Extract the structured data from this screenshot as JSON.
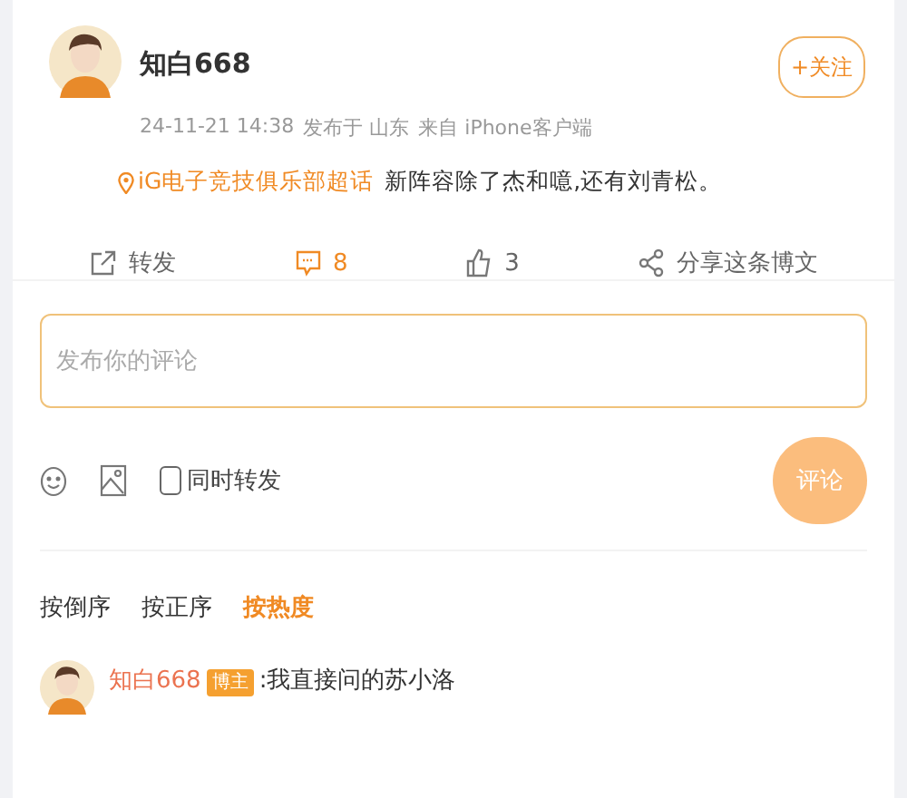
{
  "post": {
    "author": "知白668",
    "follow_button": "+关注",
    "time": "24-11-21 14:38",
    "location": "发布于 山东",
    "source": "来自 iPhone客户端",
    "topic": "iG电子竞技俱乐部超话",
    "text": "新阵容除了杰和噫,还有刘青松。"
  },
  "actions": [
    {
      "kind": "repost",
      "label": "转发",
      "selected": false
    },
    {
      "kind": "comment",
      "label": "8",
      "selected": true
    },
    {
      "kind": "like",
      "label": "3",
      "selected": false
    },
    {
      "kind": "share",
      "label": "分享这条博文",
      "selected": false
    }
  ],
  "composer": {
    "placeholder": "发布你的评论",
    "also_repost": {
      "label": "同时转发",
      "checked": false
    },
    "submit": "评论"
  },
  "sort_tabs": [
    {
      "label": "按倒序",
      "selected": false
    },
    {
      "label": "按正序",
      "selected": false
    },
    {
      "label": "按热度",
      "selected": true
    }
  ],
  "comments": [
    {
      "author": "知白668",
      "badge": "博主",
      "text": ":我直接问的苏小洛"
    }
  ]
}
